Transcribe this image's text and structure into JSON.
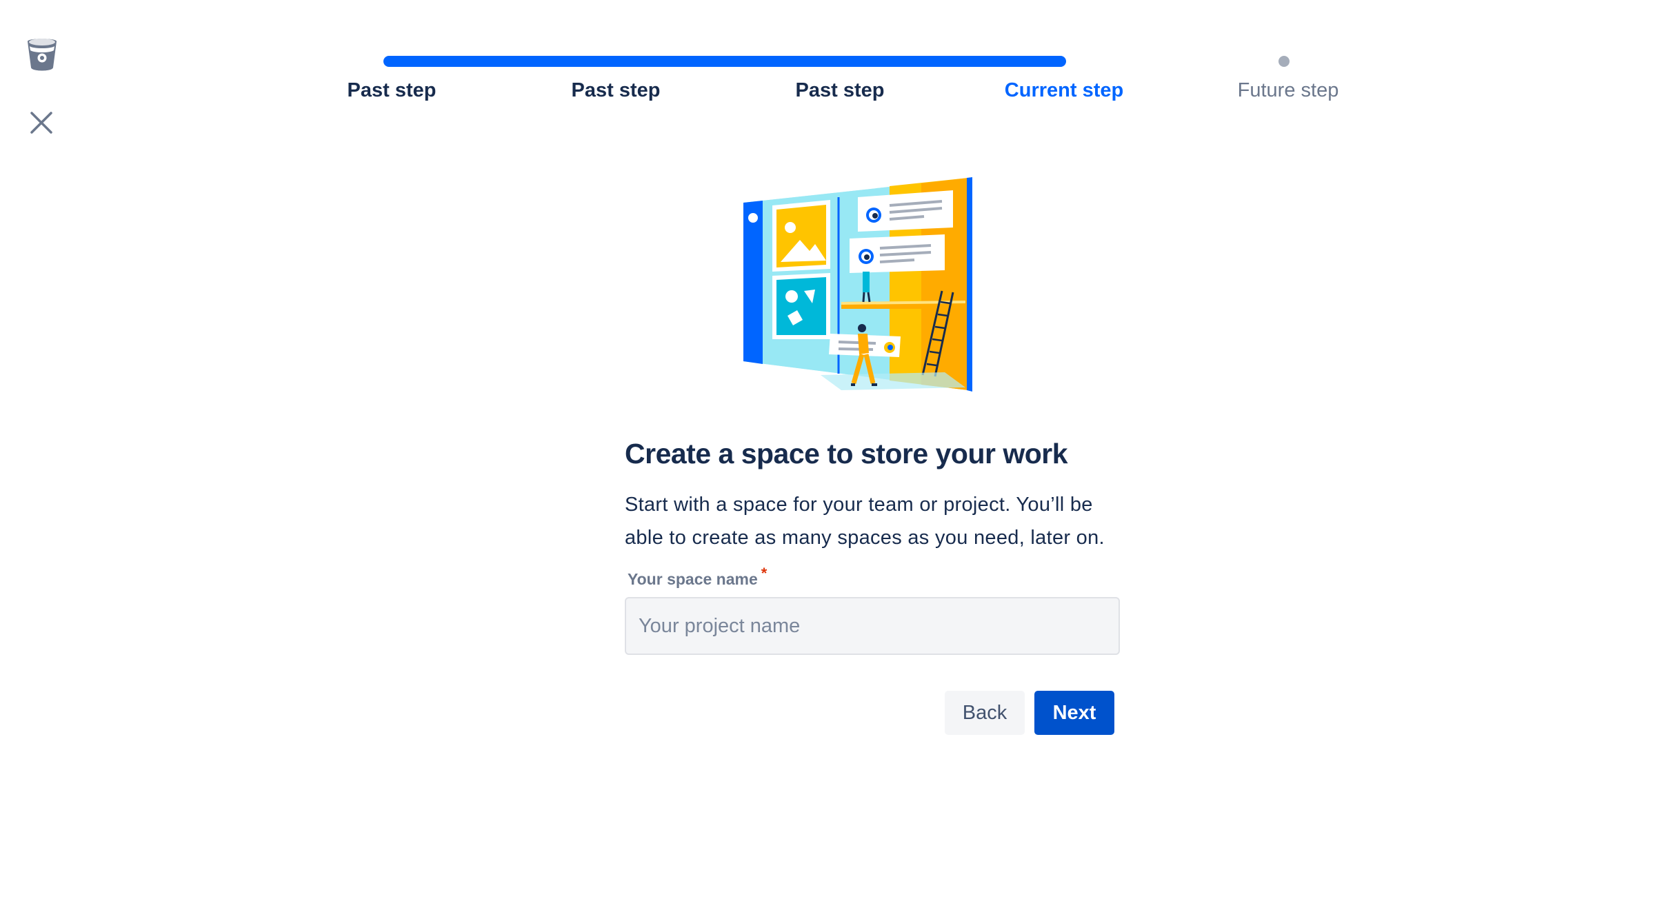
{
  "colors": {
    "primary": "#0052cc",
    "progress": "#0065ff",
    "current_step": "#0065ff",
    "future_dot": "#a5adba",
    "required": "#de350b",
    "text_dark": "#172b4d",
    "text_muted": "#6b778c"
  },
  "icons": {
    "logo": "bitbucket-logo",
    "close": "close-icon"
  },
  "progress": {
    "steps": [
      {
        "label": "Past step",
        "state": "past"
      },
      {
        "label": "Past step",
        "state": "past"
      },
      {
        "label": "Past step",
        "state": "past"
      },
      {
        "label": "Current step",
        "state": "current"
      },
      {
        "label": "Future step",
        "state": "future"
      }
    ],
    "current_index": 3
  },
  "main": {
    "title": "Create a space to store your work",
    "description_line1": "Start with a space for your team or project. You’ll be",
    "description_line2": "able to create as many spaces as you need, later on.",
    "field_label": "Your space name",
    "required_mark": "*",
    "input_value": "",
    "input_placeholder": "Your project name"
  },
  "actions": {
    "back_label": "Back",
    "next_label": "Next"
  }
}
